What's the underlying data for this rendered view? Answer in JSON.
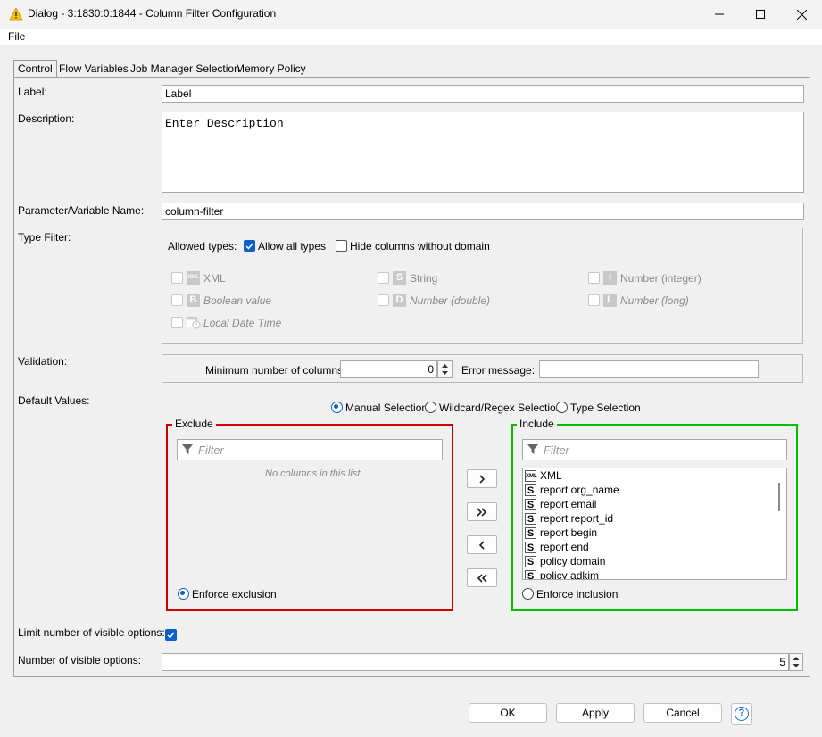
{
  "window": {
    "title": "Dialog - 3:1830:0:1844 - Column Filter Configuration",
    "minimize": "—",
    "maximize": "☐",
    "close": "✕"
  },
  "menu": {
    "file": "File"
  },
  "tabs": [
    "Control",
    "Flow Variables",
    "Job Manager Selection",
    "Memory Policy"
  ],
  "form": {
    "label_label": "Label:",
    "label_value": "Label",
    "description_label": "Description:",
    "description_value": "Enter Description",
    "param_label": "Parameter/Variable Name:",
    "param_value": "column-filter",
    "type_filter_label": "Type Filter:",
    "allowed_types": "Allowed types:",
    "allow_all": "Allow all types",
    "hide_without_domain": "Hide columns without domain",
    "types": {
      "xml": "XML",
      "string": "String",
      "number_integer": "Number (integer)",
      "boolean": "Boolean value",
      "number_double": "Number (double)",
      "number_long": "Number (long)",
      "local_date_time": "Local Date Time"
    },
    "validation_label": "Validation:",
    "min_cols_label": "Minimum number of columns:",
    "min_cols_value": "0",
    "error_message_label": "Error message:",
    "default_values_label": "Default Values:",
    "mode_manual": "Manual Selection",
    "mode_wildcard": "Wildcard/Regex Selection",
    "mode_type": "Type Selection",
    "exclude_title": "Exclude",
    "include_title": "Include",
    "filter_placeholder": "Filter",
    "no_columns": "No columns in this list",
    "enforce_exclusion": "Enforce exclusion",
    "enforce_inclusion": "Enforce inclusion",
    "include_items": [
      {
        "badge": "XML",
        "name": "XML"
      },
      {
        "badge": "S",
        "name": "report org_name"
      },
      {
        "badge": "S",
        "name": "report email"
      },
      {
        "badge": "S",
        "name": "report report_id"
      },
      {
        "badge": "S",
        "name": "report begin"
      },
      {
        "badge": "S",
        "name": "report end"
      },
      {
        "badge": "S",
        "name": "policy domain"
      },
      {
        "badge": "S",
        "name": "policy adkim"
      }
    ],
    "limit_visible_label": "Limit number of visible options:",
    "num_visible_label": "Number of visible options:",
    "num_visible_value": "5"
  },
  "buttons": {
    "ok": "OK",
    "apply": "Apply",
    "cancel": "Cancel",
    "help": "?"
  },
  "colors": {
    "exclude_border": "#d00000",
    "include_border": "#00c000",
    "accent": "#0b5fc6"
  }
}
